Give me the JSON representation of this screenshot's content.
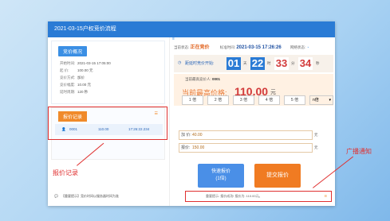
{
  "window": {
    "title": "2021-03-15户权竞价流程"
  },
  "info": {
    "header": "竞价概况",
    "rows": [
      {
        "label": "开始时间:",
        "value": "2021-03-15 17:05:00"
      },
      {
        "label": "起 价:",
        "value": "100.00 元"
      },
      {
        "label": "竞价方式:",
        "value": "加价"
      },
      {
        "label": "竞价幅度:",
        "value": "10.00 元"
      },
      {
        "label": "延时周期:",
        "value": "120 秒"
      }
    ]
  },
  "records": {
    "header": "报价记录",
    "rows": [
      {
        "bidder": "0001",
        "price": "110.00",
        "time": "17:26:22.234"
      }
    ]
  },
  "notice": "【重要提示】竞价时间以服务器时间为准",
  "status": {
    "label": "当前状态:",
    "value": "正在竞价",
    "server_label": "标准时间:",
    "server_time": "2021-03-15 17:26:26",
    "network_label": "网络状态:"
  },
  "countdown": {
    "label": "距延时竞价开始:",
    "days": "01",
    "days_unit": "天",
    "hours": "22",
    "hours_unit": "时",
    "minutes": "33",
    "minutes_unit": "分",
    "seconds": "34",
    "seconds_unit": "秒"
  },
  "price": {
    "bidder_label": "当前最高竞价人:",
    "bidder": "0001",
    "label": "当前最高价格:",
    "value": "110.00",
    "unit": "元"
  },
  "multipliers": [
    "1 倍",
    "2 倍",
    "3 倍",
    "4 倍",
    "5 倍"
  ],
  "multiplier_select": "n倍",
  "inputs": {
    "add_label": "加 价:",
    "add_value": "40.00",
    "bid_label": "报价:",
    "bid_value": "150.00",
    "unit": "元"
  },
  "buttons": {
    "quick_line1": "快速报价",
    "quick_line2": "(1倍)",
    "submit": "提交报价"
  },
  "broadcast": "重要提示: 报价成功! 报价为: 110.00元。",
  "annotations": {
    "records": "报价记录",
    "broadcast": "广播通知"
  },
  "colors": {
    "accent": "#2a7bd5",
    "orange": "#f07b22",
    "red": "#e03030"
  }
}
